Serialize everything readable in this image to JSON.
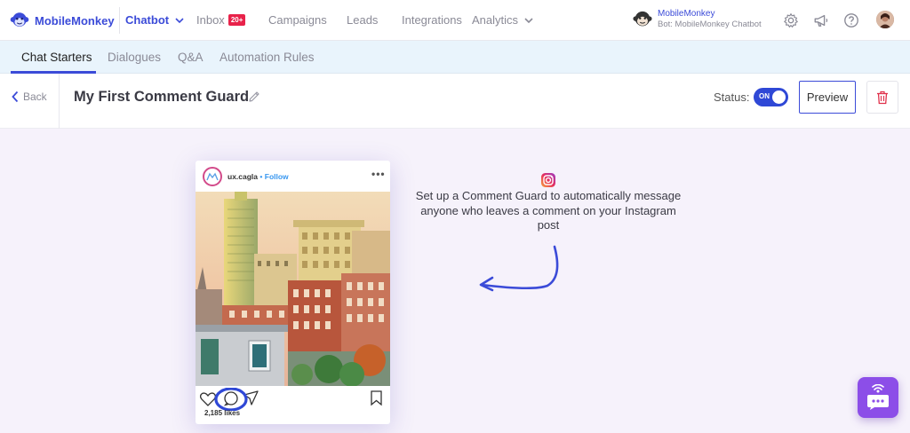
{
  "brand": {
    "name": "MobileMonkey",
    "logo_icon": "monkey-logo-icon"
  },
  "nav": {
    "items": [
      {
        "label": "Chatbot",
        "active": true,
        "has_dropdown": true
      },
      {
        "label": "Inbox",
        "badge": "20+"
      },
      {
        "label": "Campaigns"
      },
      {
        "label": "Leads"
      },
      {
        "label": "Integrations"
      },
      {
        "label": "Analytics",
        "has_dropdown": true
      }
    ]
  },
  "account": {
    "name": "MobileMonkey",
    "subtitle": "Bot: MobileMonkey Chatbot"
  },
  "top_icons": [
    "gear-icon",
    "megaphone-icon",
    "help-icon",
    "user-avatar"
  ],
  "subnav": {
    "tabs": [
      {
        "label": "Chat Starters",
        "active": true
      },
      {
        "label": "Dialogues"
      },
      {
        "label": "Q&A"
      },
      {
        "label": "Automation Rules"
      }
    ]
  },
  "header": {
    "back_label": "Back",
    "title": "My First Comment Guard",
    "status_label": "Status:",
    "toggle_label": "ON",
    "toggle_on": true,
    "preview_label": "Preview"
  },
  "post": {
    "username": "ux.cagla",
    "follow_label": "Follow",
    "more": "•••",
    "likes": "2,185 likes"
  },
  "info": {
    "text": "Set up a Comment Guard to automatically message anyone who leaves a comment on your Instagram post"
  },
  "colors": {
    "accent": "#3b4bd8",
    "badge": "#e8224a",
    "subnav_bg": "#e9f4fc",
    "canvas_bg": "#f6f2fb",
    "delete": "#e0304a",
    "chat_widget": "#8c4ee8"
  }
}
